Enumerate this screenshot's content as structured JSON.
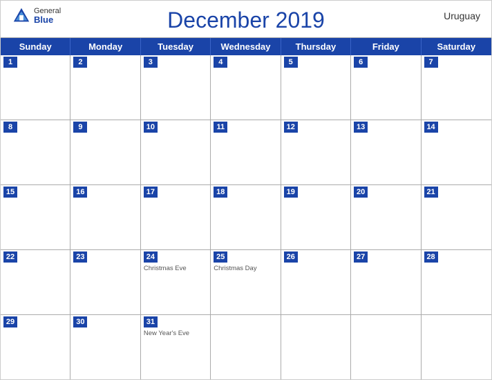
{
  "header": {
    "title": "December 2019",
    "country": "Uruguay",
    "logo": {
      "general": "General",
      "blue": "Blue"
    }
  },
  "dayHeaders": [
    "Sunday",
    "Monday",
    "Tuesday",
    "Wednesday",
    "Thursday",
    "Friday",
    "Saturday"
  ],
  "weeks": [
    [
      {
        "num": "1",
        "events": []
      },
      {
        "num": "2",
        "events": []
      },
      {
        "num": "3",
        "events": []
      },
      {
        "num": "4",
        "events": []
      },
      {
        "num": "5",
        "events": []
      },
      {
        "num": "6",
        "events": []
      },
      {
        "num": "7",
        "events": []
      }
    ],
    [
      {
        "num": "8",
        "events": []
      },
      {
        "num": "9",
        "events": []
      },
      {
        "num": "10",
        "events": []
      },
      {
        "num": "11",
        "events": []
      },
      {
        "num": "12",
        "events": []
      },
      {
        "num": "13",
        "events": []
      },
      {
        "num": "14",
        "events": []
      }
    ],
    [
      {
        "num": "15",
        "events": []
      },
      {
        "num": "16",
        "events": []
      },
      {
        "num": "17",
        "events": []
      },
      {
        "num": "18",
        "events": []
      },
      {
        "num": "19",
        "events": []
      },
      {
        "num": "20",
        "events": []
      },
      {
        "num": "21",
        "events": []
      }
    ],
    [
      {
        "num": "22",
        "events": []
      },
      {
        "num": "23",
        "events": []
      },
      {
        "num": "24",
        "events": [
          "Christmas Eve"
        ]
      },
      {
        "num": "25",
        "events": [
          "Christmas Day"
        ]
      },
      {
        "num": "26",
        "events": []
      },
      {
        "num": "27",
        "events": []
      },
      {
        "num": "28",
        "events": []
      }
    ],
    [
      {
        "num": "29",
        "events": []
      },
      {
        "num": "30",
        "events": []
      },
      {
        "num": "31",
        "events": [
          "New Year's Eve"
        ]
      },
      {
        "num": "",
        "events": []
      },
      {
        "num": "",
        "events": []
      },
      {
        "num": "",
        "events": []
      },
      {
        "num": "",
        "events": []
      }
    ]
  ]
}
